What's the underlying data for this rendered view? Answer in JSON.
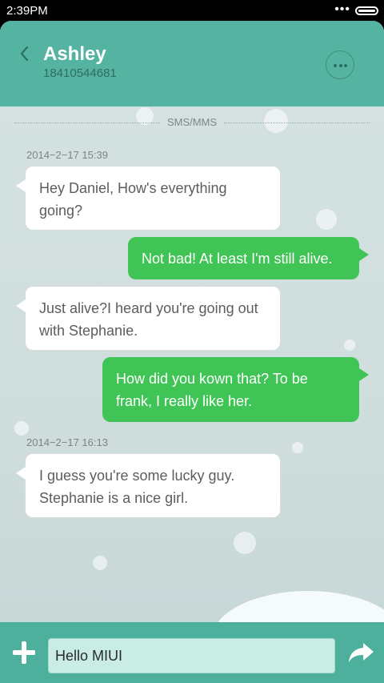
{
  "status_bar": {
    "time": "2:39PM",
    "dots": "•••"
  },
  "header": {
    "contact_name": "Ashley",
    "contact_number": "18410544681"
  },
  "channel_label": "SMS/MMS",
  "messages": [
    {
      "timestamp": "2014−2−17 15:39"
    },
    {
      "direction": "in",
      "text": "Hey Daniel, How's everything going?"
    },
    {
      "direction": "out",
      "text": "Not bad! At least I'm still alive."
    },
    {
      "direction": "in",
      "text": "Just  alive?I heard you're going out with Stephanie."
    },
    {
      "direction": "out",
      "text": "How did you kown that? To be frank, I really like her."
    },
    {
      "timestamp": "2014−2−17 16:13"
    },
    {
      "direction": "in",
      "text": "I guess you're some lucky guy. Stephanie is a nice girl."
    }
  ],
  "composer": {
    "value": "Hello MIUI"
  },
  "colors": {
    "header": "#55b3a1",
    "outgoing_bubble": "#40c456",
    "incoming_bubble": "#ffffff",
    "input_bar": "#4db09c"
  },
  "icons": [
    "back-chevron-icon",
    "more-options-icon",
    "plus-icon",
    "send-arrow-icon",
    "battery-icon"
  ]
}
